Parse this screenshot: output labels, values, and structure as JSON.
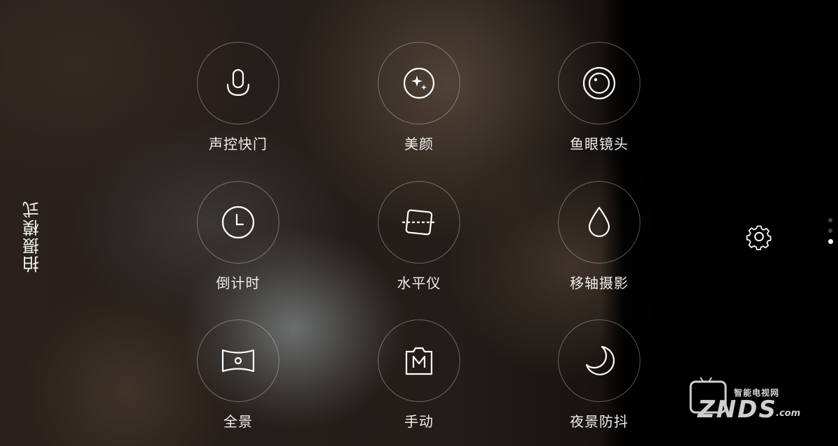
{
  "sidebar": {
    "title": "拍摄模式"
  },
  "modes": [
    {
      "label": "声控快门",
      "icon": "microphone-icon"
    },
    {
      "label": "美颜",
      "icon": "beauty-sparkle-icon"
    },
    {
      "label": "鱼眼镜头",
      "icon": "fisheye-icon"
    },
    {
      "label": "倒计时",
      "icon": "clock-icon"
    },
    {
      "label": "水平仪",
      "icon": "level-icon"
    },
    {
      "label": "移轴摄影",
      "icon": "tilt-shift-drop-icon"
    },
    {
      "label": "全景",
      "icon": "panorama-icon"
    },
    {
      "label": "手动",
      "icon": "manual-m-icon"
    },
    {
      "label": "夜景防抖",
      "icon": "moon-icon"
    }
  ],
  "right_panel": {
    "settings_icon": "gear-icon",
    "page_dots": 3,
    "active_page": 3
  },
  "watermark": {
    "top_text": "智能电视网",
    "brand": "ZNDS",
    "suffix": ".com"
  }
}
